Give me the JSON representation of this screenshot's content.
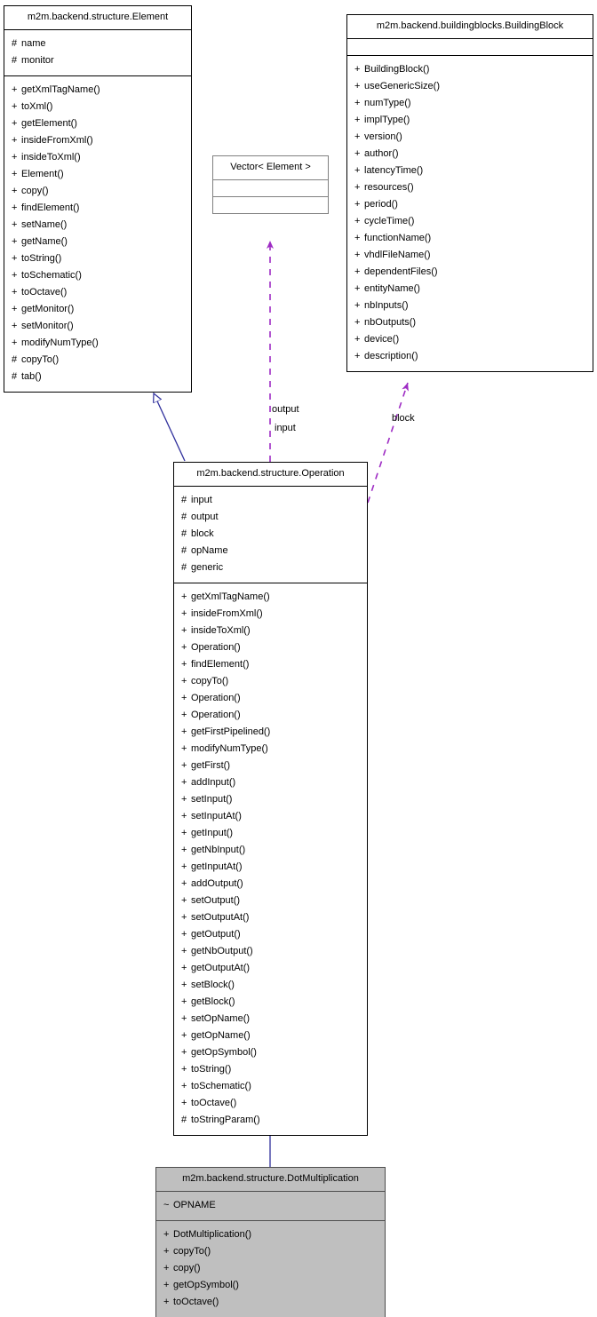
{
  "diagram": {
    "title": "UML class diagram",
    "colors": {
      "inheritance_edge": "#2f2f9c",
      "dependency_edge": "#9e2cc4",
      "highlight_fill": "#bfbfbf",
      "box_border": "#000000",
      "thin_border": "#808080",
      "background": "#ffffff"
    }
  },
  "classes": {
    "element": {
      "name": "m2m.backend.structure.Element",
      "attributes": [
        {
          "visibility": "#",
          "label": "name"
        },
        {
          "visibility": "#",
          "label": "monitor"
        }
      ],
      "operations": [
        {
          "visibility": "+",
          "label": "getXmlTagName()"
        },
        {
          "visibility": "+",
          "label": "toXml()"
        },
        {
          "visibility": "+",
          "label": "getElement()"
        },
        {
          "visibility": "+",
          "label": "insideFromXml()"
        },
        {
          "visibility": "+",
          "label": "insideToXml()"
        },
        {
          "visibility": "+",
          "label": "Element()"
        },
        {
          "visibility": "+",
          "label": "copy()"
        },
        {
          "visibility": "+",
          "label": "findElement()"
        },
        {
          "visibility": "+",
          "label": "setName()"
        },
        {
          "visibility": "+",
          "label": "getName()"
        },
        {
          "visibility": "+",
          "label": "toString()"
        },
        {
          "visibility": "+",
          "label": "toSchematic()"
        },
        {
          "visibility": "+",
          "label": "toOctave()"
        },
        {
          "visibility": "+",
          "label": "getMonitor()"
        },
        {
          "visibility": "+",
          "label": "setMonitor()"
        },
        {
          "visibility": "+",
          "label": "modifyNumType()"
        },
        {
          "visibility": "#",
          "label": "copyTo()"
        },
        {
          "visibility": "#",
          "label": "tab()"
        }
      ]
    },
    "buildingblock": {
      "name": "m2m.backend.buildingblocks.BuildingBlock",
      "attributes": [],
      "operations": [
        {
          "visibility": "+",
          "label": "BuildingBlock()"
        },
        {
          "visibility": "+",
          "label": "useGenericSize()"
        },
        {
          "visibility": "+",
          "label": "numType()"
        },
        {
          "visibility": "+",
          "label": "implType()"
        },
        {
          "visibility": "+",
          "label": "version()"
        },
        {
          "visibility": "+",
          "label": "author()"
        },
        {
          "visibility": "+",
          "label": "latencyTime()"
        },
        {
          "visibility": "+",
          "label": "resources()"
        },
        {
          "visibility": "+",
          "label": "period()"
        },
        {
          "visibility": "+",
          "label": "cycleTime()"
        },
        {
          "visibility": "+",
          "label": "functionName()"
        },
        {
          "visibility": "+",
          "label": "vhdlFileName()"
        },
        {
          "visibility": "+",
          "label": "dependentFiles()"
        },
        {
          "visibility": "+",
          "label": "entityName()"
        },
        {
          "visibility": "+",
          "label": "nbInputs()"
        },
        {
          "visibility": "+",
          "label": "nbOutputs()"
        },
        {
          "visibility": "+",
          "label": "device()"
        },
        {
          "visibility": "+",
          "label": "description()"
        }
      ]
    },
    "vector": {
      "name": "Vector< Element >",
      "attributes": [],
      "operations": []
    },
    "operation": {
      "name": "m2m.backend.structure.Operation",
      "attributes": [
        {
          "visibility": "#",
          "label": "input"
        },
        {
          "visibility": "#",
          "label": "output"
        },
        {
          "visibility": "#",
          "label": "block"
        },
        {
          "visibility": "#",
          "label": "opName"
        },
        {
          "visibility": "#",
          "label": "generic"
        }
      ],
      "operations": [
        {
          "visibility": "+",
          "label": "getXmlTagName()"
        },
        {
          "visibility": "+",
          "label": "insideFromXml()"
        },
        {
          "visibility": "+",
          "label": "insideToXml()"
        },
        {
          "visibility": "+",
          "label": "Operation()"
        },
        {
          "visibility": "+",
          "label": "findElement()"
        },
        {
          "visibility": "+",
          "label": "copyTo()"
        },
        {
          "visibility": "+",
          "label": "Operation()"
        },
        {
          "visibility": "+",
          "label": "Operation()"
        },
        {
          "visibility": "+",
          "label": "getFirstPipelined()"
        },
        {
          "visibility": "+",
          "label": "modifyNumType()"
        },
        {
          "visibility": "+",
          "label": "getFirst()"
        },
        {
          "visibility": "+",
          "label": "addInput()"
        },
        {
          "visibility": "+",
          "label": "setInput()"
        },
        {
          "visibility": "+",
          "label": "setInputAt()"
        },
        {
          "visibility": "+",
          "label": "getInput()"
        },
        {
          "visibility": "+",
          "label": "getNbInput()"
        },
        {
          "visibility": "+",
          "label": "getInputAt()"
        },
        {
          "visibility": "+",
          "label": "addOutput()"
        },
        {
          "visibility": "+",
          "label": "setOutput()"
        },
        {
          "visibility": "+",
          "label": "setOutputAt()"
        },
        {
          "visibility": "+",
          "label": "getOutput()"
        },
        {
          "visibility": "+",
          "label": "getNbOutput()"
        },
        {
          "visibility": "+",
          "label": "getOutputAt()"
        },
        {
          "visibility": "+",
          "label": "setBlock()"
        },
        {
          "visibility": "+",
          "label": "getBlock()"
        },
        {
          "visibility": "+",
          "label": "setOpName()"
        },
        {
          "visibility": "+",
          "label": "getOpName()"
        },
        {
          "visibility": "+",
          "label": "getOpSymbol()"
        },
        {
          "visibility": "+",
          "label": "toString()"
        },
        {
          "visibility": "+",
          "label": "toSchematic()"
        },
        {
          "visibility": "+",
          "label": "toOctave()"
        },
        {
          "visibility": "#",
          "label": "toStringParam()"
        }
      ]
    },
    "dotmultiplication": {
      "name": "m2m.backend.structure.DotMultiplication",
      "attributes": [
        {
          "visibility": "~",
          "label": "OPNAME"
        }
      ],
      "operations": [
        {
          "visibility": "+",
          "label": "DotMultiplication()"
        },
        {
          "visibility": "+",
          "label": "copyTo()"
        },
        {
          "visibility": "+",
          "label": "copy()"
        },
        {
          "visibility": "+",
          "label": "getOpSymbol()"
        },
        {
          "visibility": "+",
          "label": "toOctave()"
        }
      ]
    }
  },
  "edges": {
    "element_to_operation": {
      "kind": "inheritance",
      "label": ""
    },
    "operation_to_dotmultiplication": {
      "kind": "inheritance",
      "label": ""
    },
    "vector_to_operation_output": {
      "kind": "dependency",
      "label": "output"
    },
    "vector_to_operation_input": {
      "kind": "dependency",
      "label": "input"
    },
    "buildingblock_to_operation": {
      "kind": "dependency",
      "label": "block"
    }
  }
}
